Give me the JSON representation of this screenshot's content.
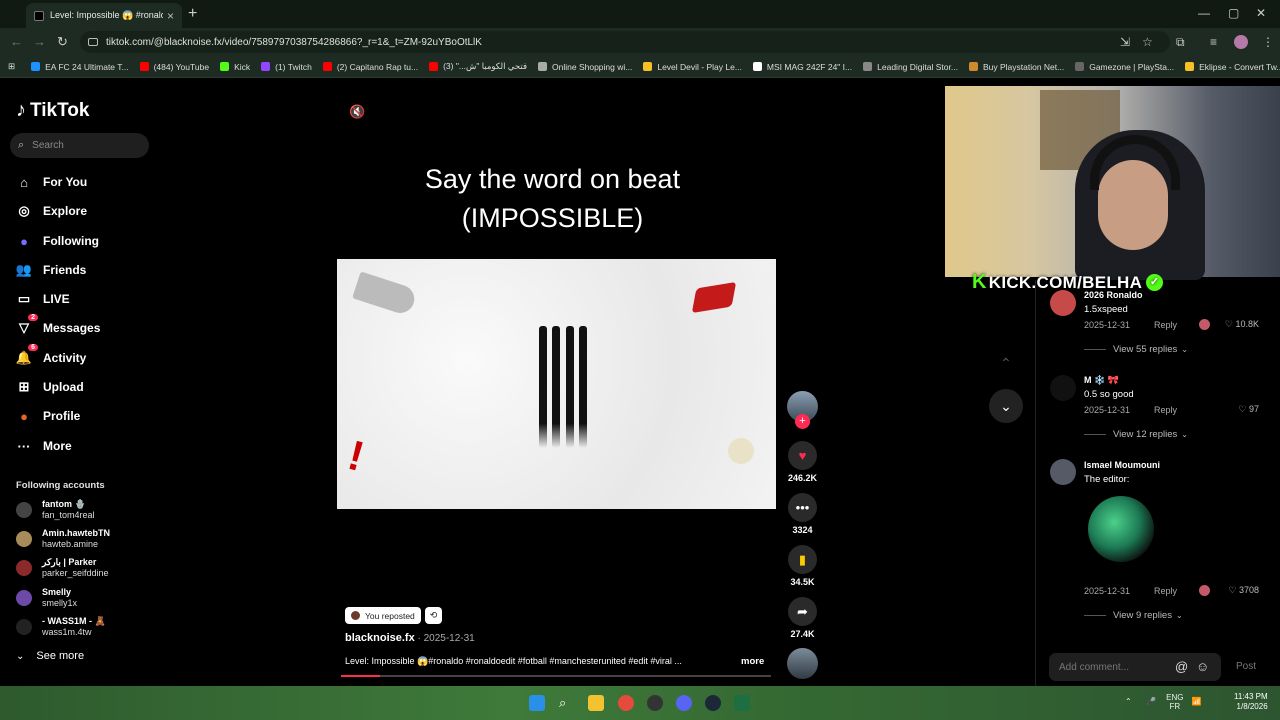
{
  "browser": {
    "tab_title": "Level: Impossible 😱 #ronaldo",
    "new_tab": "+",
    "url": "tiktok.com/@blacknoise.fx/video/7589797038754286866?_r=1&_t=ZM-92uYBoOtLlK",
    "bookmarks": [
      {
        "label": "EA FC 24 Ultimate T...",
        "color": "#1e90ff"
      },
      {
        "label": "(484) YouTube",
        "color": "#ff0000"
      },
      {
        "label": "Kick",
        "color": "#53fc18"
      },
      {
        "label": "(1) Twitch",
        "color": "#9146ff"
      },
      {
        "label": "(2) Capitano Rap tu...",
        "color": "#ff0000"
      },
      {
        "label": "فتحي الكومبا \"ش...\" (3)",
        "color": "#ff0000"
      },
      {
        "label": "Online Shopping wi...",
        "color": "#aaaaaa"
      },
      {
        "label": "Level Devil - Play Le...",
        "color": "#f6c026"
      },
      {
        "label": "MSI MAG 242F 24\" I...",
        "color": "#ffffff"
      },
      {
        "label": "Leading Digital Stor...",
        "color": "#888888"
      },
      {
        "label": "Buy Playstation Net...",
        "color": "#d08a2c"
      },
      {
        "label": "Gamezone | PlaySta...",
        "color": "#666666"
      },
      {
        "label": "Eklipse - Convert Tw...",
        "color": "#f6c026"
      }
    ]
  },
  "sidebar": {
    "logo": "TikTok",
    "search_placeholder": "Search",
    "items": [
      {
        "label": "For You",
        "icon": "home-icon"
      },
      {
        "label": "Explore",
        "icon": "compass-icon"
      },
      {
        "label": "Following",
        "icon": "following-icon"
      },
      {
        "label": "Friends",
        "icon": "friends-icon"
      },
      {
        "label": "LIVE",
        "icon": "live-icon"
      },
      {
        "label": "Messages",
        "icon": "messages-icon",
        "badge": "2"
      },
      {
        "label": "Activity",
        "icon": "activity-icon",
        "badge": "6"
      },
      {
        "label": "Upload",
        "icon": "upload-icon"
      },
      {
        "label": "Profile",
        "icon": "profile-icon"
      },
      {
        "label": "More",
        "icon": "more-icon"
      }
    ],
    "following_title": "Following accounts",
    "accounts": [
      {
        "name": "fantom 🪬",
        "user": "fan_tom4real",
        "color": "#444444"
      },
      {
        "name": "Amin.hawtebTN",
        "user": "hawteb.amine",
        "color": "#a88b5a"
      },
      {
        "name": "باركر | Parker",
        "user": "parker_seifddine",
        "color": "#8b2a2a"
      },
      {
        "name": "Smelly",
        "user": "smelly1x",
        "color": "#6e4aa8"
      },
      {
        "name": "- WASS1M - 🧸",
        "user": "wass1m.4tw",
        "color": "#222222"
      }
    ],
    "see_more": "See more"
  },
  "video": {
    "title_line1": "Say the word on beat",
    "title_line2": "(IMPOSSIBLE)",
    "reposted_label": "You reposted",
    "author": "blacknoise.fx",
    "date": "2025-12-31",
    "caption": "Level: Impossible 😱#ronaldo #ronaldoedit #fotball #manchesterunited #edit #viral ...",
    "more": "more",
    "progress": 0.09,
    "likes": "246.2K",
    "comments": "3324",
    "saves": "34.5K",
    "shares": "27.4K"
  },
  "stream": {
    "overlay": "KICK.COM/BELHA"
  },
  "comments": {
    "items": [
      {
        "name": "2026 Ronaldo",
        "text": "1.5xspeed",
        "date": "2025-12-31",
        "reply": "Reply",
        "likes": "10.8K",
        "view_replies": "View 55 replies"
      },
      {
        "name": "M ❄️ 🎀",
        "text": "0.5 so good",
        "date": "2025-12-31",
        "reply": "Reply",
        "likes": "97",
        "view_replies": "View 12 replies"
      },
      {
        "name": "Ismael Moumouni",
        "text": "The editor:",
        "date": "2025-12-31",
        "reply": "Reply",
        "likes": "3708",
        "view_replies": "View 9 replies"
      }
    ],
    "input_placeholder": "Add comment...",
    "post": "Post"
  },
  "taskbar": {
    "lang1": "ENG",
    "lang2": "FR",
    "time": "11:43 PM",
    "date": "1/8/2026"
  }
}
